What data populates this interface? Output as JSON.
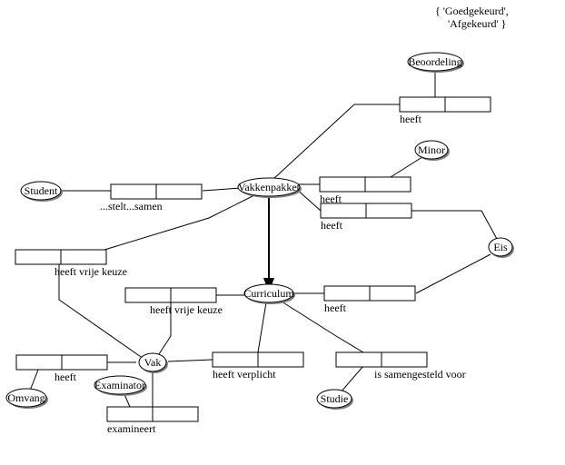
{
  "constraint": {
    "open": "{",
    "v1": "'Goedgekeurd',",
    "v2": "'Afgekeurd'",
    "close": "}"
  },
  "entities": {
    "beoordeling": "Beoordeling",
    "minor": "Minor",
    "student": "Student",
    "vakkenpakket": "Vakkenpakket",
    "eis": "Eis",
    "curriculum": "Curriculum",
    "vak": "Vak",
    "omvang": "Omvang",
    "examinator": "Examinator",
    "studie": "Studie"
  },
  "labels": {
    "heeft_beoord": "heeft",
    "heeft_minor": "heeft",
    "stelt_samen": "...stelt...samen",
    "heeft_eis_vp": "heeft",
    "heeft_vrije_keuze_vp": "heeft vrije keuze",
    "heeft_vrije_keuze_cur": "heeft vrije keuze",
    "heeft_eis_cur": "heeft",
    "heeft_omvang": "heeft",
    "heeft_verplicht": "heeft verplicht",
    "is_samengesteld": "is samengesteld voor",
    "examineert": "examineert"
  }
}
